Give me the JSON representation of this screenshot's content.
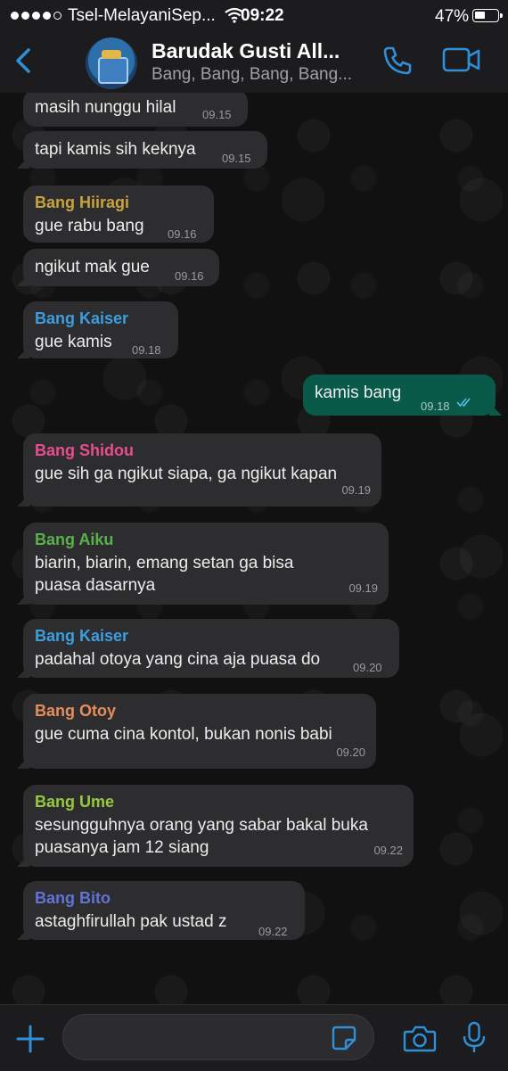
{
  "status_bar": {
    "carrier": "Tsel-MelayaniSep...",
    "time": "09:22",
    "battery": "47%"
  },
  "header": {
    "title": "Barudak Gusti All...",
    "subtitle": "Bang, Bang, Bang, Bang...",
    "back_icon": "chevron-left-icon",
    "call_icon": "phone-icon",
    "video_icon": "video-camera-icon"
  },
  "colors": {
    "accent": "#2f8fd8",
    "outgoing_bubble": "#0a5a4a",
    "incoming_bubble": "#2d2d2f",
    "sender_hiiragi": "#c9a43c",
    "sender_kaiser": "#3a9ee0",
    "sender_shidou": "#e94d8f",
    "sender_aiku": "#59b14a",
    "sender_otoy": "#e58e5c",
    "sender_ume": "#96c93d",
    "sender_bito": "#6172d8"
  },
  "messages": [
    {
      "sender": "",
      "text": "masih nunggu hilal",
      "time": "09.15"
    },
    {
      "sender": "",
      "text": "tapi kamis sih keknya",
      "time": "09.15"
    },
    {
      "sender": "Bang Hiiragi",
      "text": "gue rabu bang",
      "time": "09.16"
    },
    {
      "sender": "",
      "text": "ngikut mak gue",
      "time": "09.16"
    },
    {
      "sender": "Bang Kaiser",
      "text": "gue kamis",
      "time": "09.18"
    },
    {
      "sender": "",
      "text": "kamis bang",
      "time": "09.18",
      "outgoing": true
    },
    {
      "sender": "Bang Shidou",
      "text": "gue sih ga ngikut siapa, ga ngikut kapan",
      "time": "09.19"
    },
    {
      "sender": "Bang Aiku",
      "text": "biarin, biarin, emang setan ga bisa puasa dasarnya",
      "time": "09.19"
    },
    {
      "sender": "Bang Kaiser",
      "text": "padahal otoya yang cina aja puasa do",
      "time": "09.20"
    },
    {
      "sender": "Bang Otoy",
      "text": "gue cuma cina kontol, bukan nonis babi",
      "time": "09.20"
    },
    {
      "sender": "Bang Ume",
      "text": "sesungguhnya orang yang sabar bakal buka puasanya jam 12 siang",
      "time": "09.22"
    },
    {
      "sender": "Bang Bito",
      "text": "astaghfirullah pak ustad z",
      "time": "09.22"
    }
  ],
  "input_bar": {
    "placeholder": "",
    "icons": [
      "plus-icon",
      "sticker-icon",
      "camera-icon",
      "microphone-icon"
    ]
  }
}
